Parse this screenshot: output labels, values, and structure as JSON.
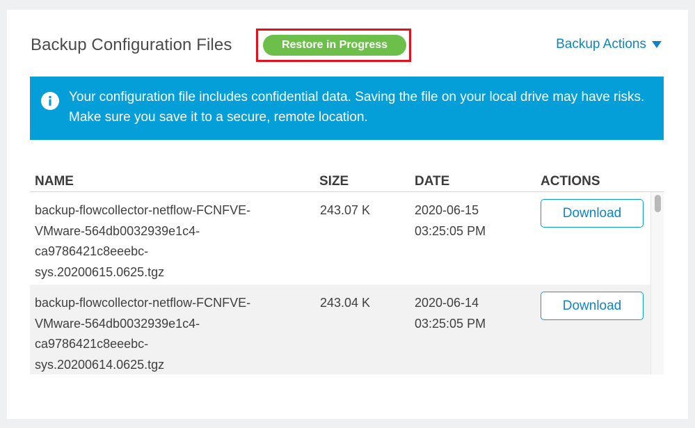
{
  "header": {
    "title": "Backup Configuration Files",
    "status_badge": "Restore in Progress",
    "actions_menu": "Backup Actions"
  },
  "alert": {
    "icon": "info-icon",
    "message": "Your configuration file includes confidential data. Saving the file on your local drive may have risks. Make sure you save it to a secure, remote location."
  },
  "table": {
    "columns": [
      "NAME",
      "SIZE",
      "DATE",
      "ACTIONS"
    ],
    "rows": [
      {
        "name_lines": [
          "backup-flowcollector-netflow-FCNFVE-",
          "VMware-564db0032939e1c4-",
          "ca9786421c8eeebc-",
          "sys.20200615.0625.tgz"
        ],
        "size": "243.07 K",
        "date_lines": [
          "2020-06-15",
          "03:25:05 PM"
        ],
        "action": "Download"
      },
      {
        "name_lines": [
          "backup-flowcollector-netflow-FCNFVE-",
          "VMware-564db0032939e1c4-",
          "ca9786421c8eeebc-",
          "sys.20200614.0625.tgz"
        ],
        "size": "243.04 K",
        "date_lines": [
          "2020-06-14",
          "03:25:05 PM"
        ],
        "action": "Download"
      }
    ]
  },
  "colors": {
    "accent_blue": "#049fd9",
    "link_blue": "#0d84c6",
    "status_green": "#6cc04a",
    "highlight_red": "#e4111b"
  }
}
